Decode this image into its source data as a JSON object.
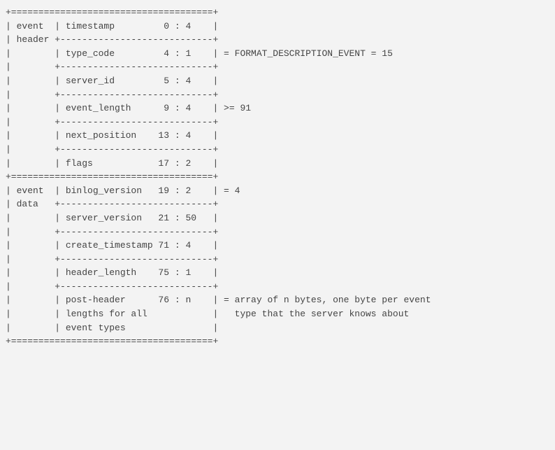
{
  "lines": [
    "+=====================================+",
    "| event  | timestamp         0 : 4    |",
    "| header +----------------------------+",
    "|        | type_code         4 : 1    | = FORMAT_DESCRIPTION_EVENT = 15",
    "|        +----------------------------+",
    "|        | server_id         5 : 4    |",
    "|        +----------------------------+",
    "|        | event_length      9 : 4    | >= 91",
    "|        +----------------------------+",
    "|        | next_position    13 : 4    |",
    "|        +----------------------------+",
    "|        | flags            17 : 2    |",
    "+=====================================+",
    "| event  | binlog_version   19 : 2    | = 4",
    "| data   +----------------------------+",
    "|        | server_version   21 : 50   |",
    "|        +----------------------------+",
    "|        | create_timestamp 71 : 4    |",
    "|        +----------------------------+",
    "|        | header_length    75 : 1    |",
    "|        +----------------------------+",
    "|        | post-header      76 : n    | = array of n bytes, one byte per event",
    "|        | lengths for all            |   type that the server knows about",
    "|        | event types                |",
    "+=====================================+"
  ]
}
